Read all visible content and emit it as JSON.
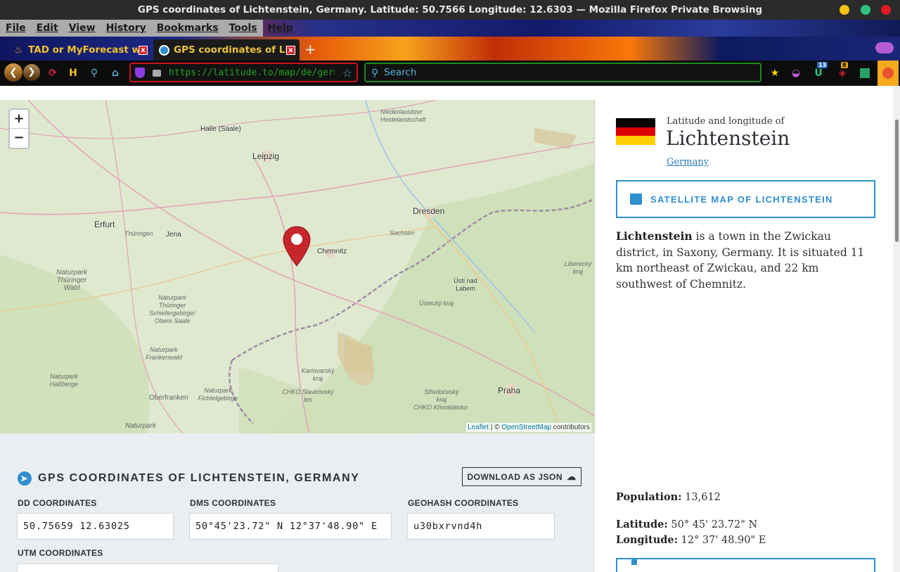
{
  "window": {
    "title": "GPS coordinates of Lichtenstein, Germany. Latitude: 50.7566 Longitude: 12.6303 — Mozilla Firefox Private Browsing"
  },
  "menu": [
    "File",
    "Edit",
    "View",
    "History",
    "Bookmarks",
    "Tools",
    "Help"
  ],
  "tabs": [
    {
      "label": "TAD or MyForecast weat",
      "close": "x"
    },
    {
      "label": "GPS coordinates of Licht",
      "close": "x"
    }
  ],
  "new_tab": "+",
  "toolbar": {
    "url": "https://latitude.to/map/de/germany",
    "search_placeholder": "Search",
    "badge_count_1": "13",
    "badge_count_2": "8"
  },
  "map": {
    "zoom_in": "+",
    "zoom_out": "−",
    "attribution_link1": "Leaflet",
    "attribution_sep": " | © ",
    "attribution_link2": "OpenStreetMap",
    "attribution_tail": " contributors",
    "labels": {
      "halle": "Halle (Saale)",
      "leipzig": "Leipzig",
      "niederlausitzer": "Niederlausitzer Heidelandschaft",
      "erfurt": "Erfurt",
      "thuringen": "Thüringen",
      "jena": "Jena",
      "dresden": "Dresden",
      "sachsen": "Sachsen",
      "chemnitz": "Chemnitz",
      "liberecky": "Liberecký kraj",
      "naturpark_thuringer_wald": "Naturpark Thüringer Wald",
      "usti": "Ústí nad Labem",
      "ustecky": "Ústecký kraj",
      "naturpark_schiefergebirge": "Naturpark Thüringer Schiefergebirge/ Obere Saale",
      "naturpark_frankenwald": "Naturpark Frankenwald",
      "karlovarsky": "Karlovarský kraj",
      "naturpark_hassberge": "Naturpark Haßberge",
      "chko_slavkovsky": "CHKO Slavkovský les",
      "stredocesky": "Středočeský kraj",
      "praha": "Praha",
      "oberfranken": "Oberfranken",
      "naturpark_fichtelgebirge": "Naturpark Fichtelgebirge",
      "chko_krivoklatsko": "CHKO Křivoklátsko",
      "naturpark_bottom": "Naturpark"
    }
  },
  "gps": {
    "title": "GPS COORDINATES OF LICHTENSTEIN, GERMANY",
    "download": "DOWNLOAD AS JSON",
    "dd_label": "DD COORDINATES",
    "dd_value": "50.75659 12.63025",
    "dms_label": "DMS COORDINATES",
    "dms_value": "50°45'23.72\" N 12°37'48.90\" E",
    "geohash_label": "GEOHASH COORDINATES",
    "geohash_value": "u30bxrvnd4h",
    "utm_label": "UTM COORDINATES"
  },
  "side": {
    "subtitle": "Latitude and longitude of",
    "place": "Lichtenstein",
    "country": "Germany",
    "satellite_button": "SATELLITE MAP OF LICHTENSTEIN",
    "desc_bold": "Lichtenstein",
    "desc_rest": " is a town in the Zwickau district, in Saxony, Germany. It is situated 11 km northeast of Zwickau, and 22 km southwest of Chemnitz.",
    "population_label": "Population:",
    "population_value": "13,612",
    "latitude_label": "Latitude:",
    "latitude_value": "50° 45' 23.72\" N",
    "longitude_label": "Longitude:",
    "longitude_value": "12° 37' 48.90\" E",
    "flag_colors": [
      "#000000",
      "#dd0000",
      "#ffce00"
    ]
  }
}
